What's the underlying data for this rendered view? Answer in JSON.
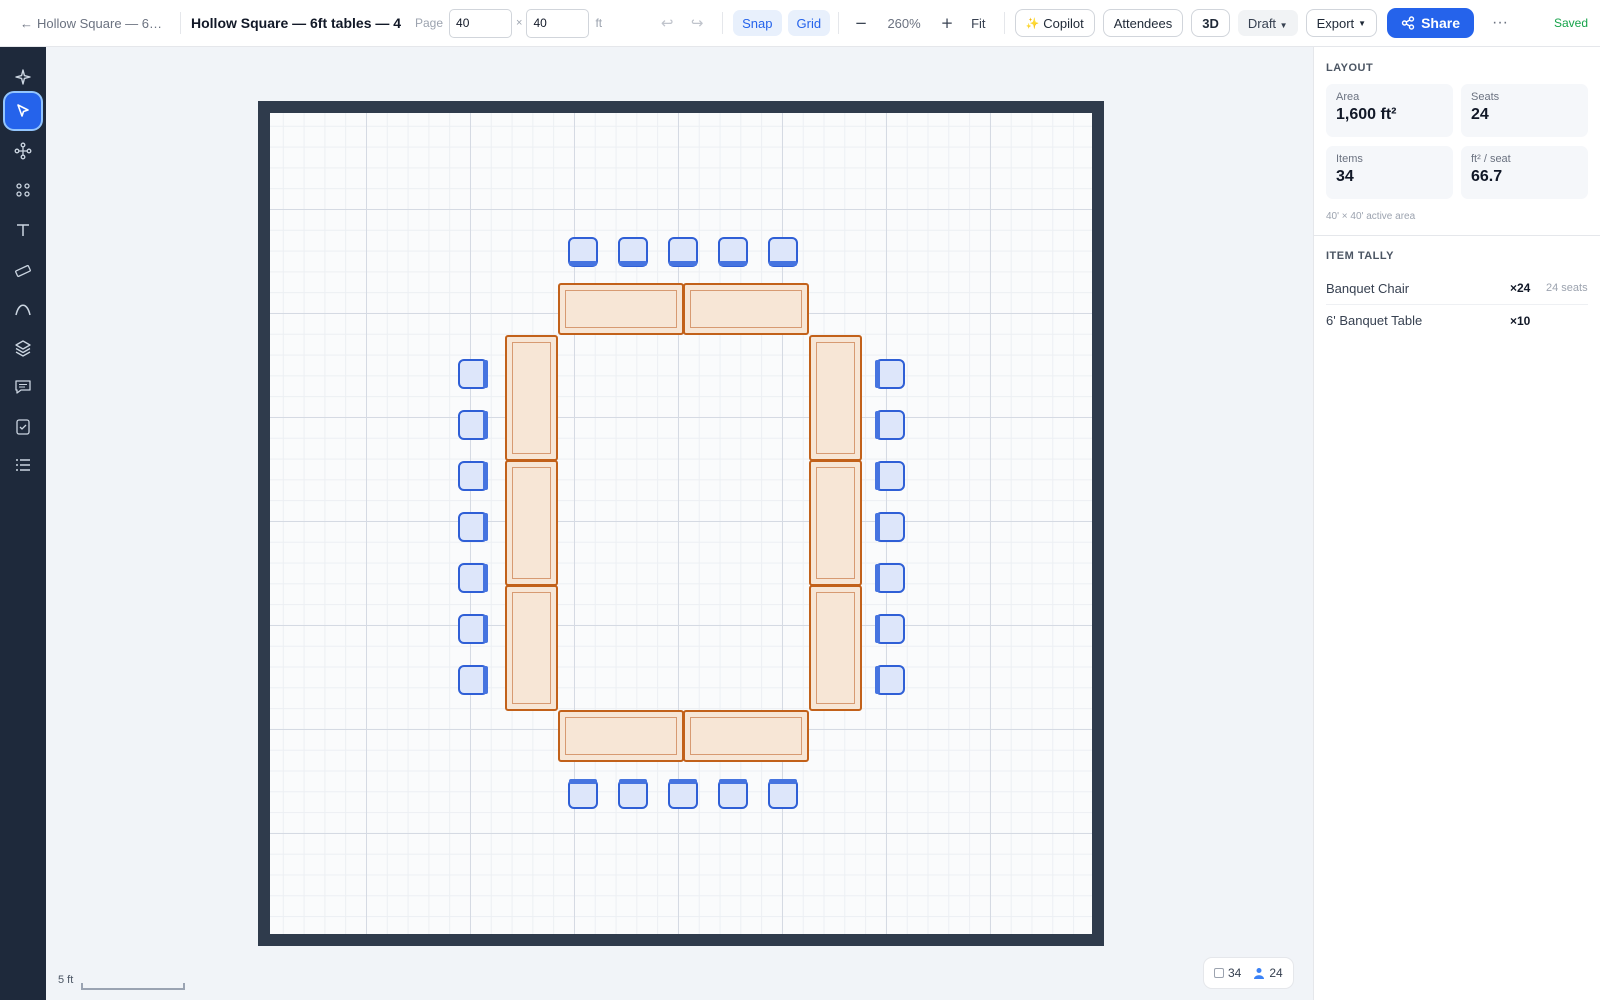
{
  "header": {
    "back_label": "Hollow Square — 6…",
    "title": "Hollow Square — 6ft tables — 4",
    "page_label": "Page",
    "page_width": "40",
    "page_height": "40",
    "times": "×",
    "unit": "ft",
    "snap_label": "Snap",
    "grid_label": "Grid",
    "zoom": "260%",
    "fit_label": "Fit",
    "copilot_label": "Copilot",
    "attendees_label": "Attendees",
    "three_d_label": "3D",
    "draft_label": "Draft",
    "export_label": "Export",
    "share_label": "Share",
    "saved_label": "Saved"
  },
  "toolbar": {
    "tools": [
      {
        "name": "sparkle-icon"
      },
      {
        "name": "cursor-icon",
        "active": true
      },
      {
        "name": "nodes-icon"
      },
      {
        "name": "grid-dots-icon"
      },
      {
        "name": "text-icon"
      },
      {
        "name": "ruler-icon"
      },
      {
        "name": "curve-icon"
      },
      {
        "name": "layers-icon"
      },
      {
        "name": "comment-icon"
      },
      {
        "name": "checklist-icon"
      },
      {
        "name": "list-icon"
      }
    ]
  },
  "canvas": {
    "scale_label": "5 ft",
    "item_count": "34",
    "seat_count": "24"
  },
  "layout": {
    "section_title": "LAYOUT",
    "stats": [
      {
        "label": "Area",
        "value": "1,600 ft²"
      },
      {
        "label": "Seats",
        "value": "24"
      },
      {
        "label": "Items",
        "value": "34"
      },
      {
        "label": "ft² / seat",
        "value": "66.7"
      }
    ],
    "area_note": "40' × 40' active area"
  },
  "tally": {
    "section_title": "ITEM TALLY",
    "rows": [
      {
        "name": "Banquet Chair",
        "count": "×24",
        "seats": "24 seats"
      },
      {
        "name": "6' Banquet Table",
        "count": "×10",
        "seats": ""
      }
    ]
  },
  "colors": {
    "accent": "#2563eb",
    "table_fill": "#f7e6d6",
    "table_stroke": "#c2611a",
    "chair_stroke": "#2f5fd6",
    "room_wall": "#2f3b4c",
    "sidebar": "#1e293b",
    "saved": "#16a34a"
  }
}
